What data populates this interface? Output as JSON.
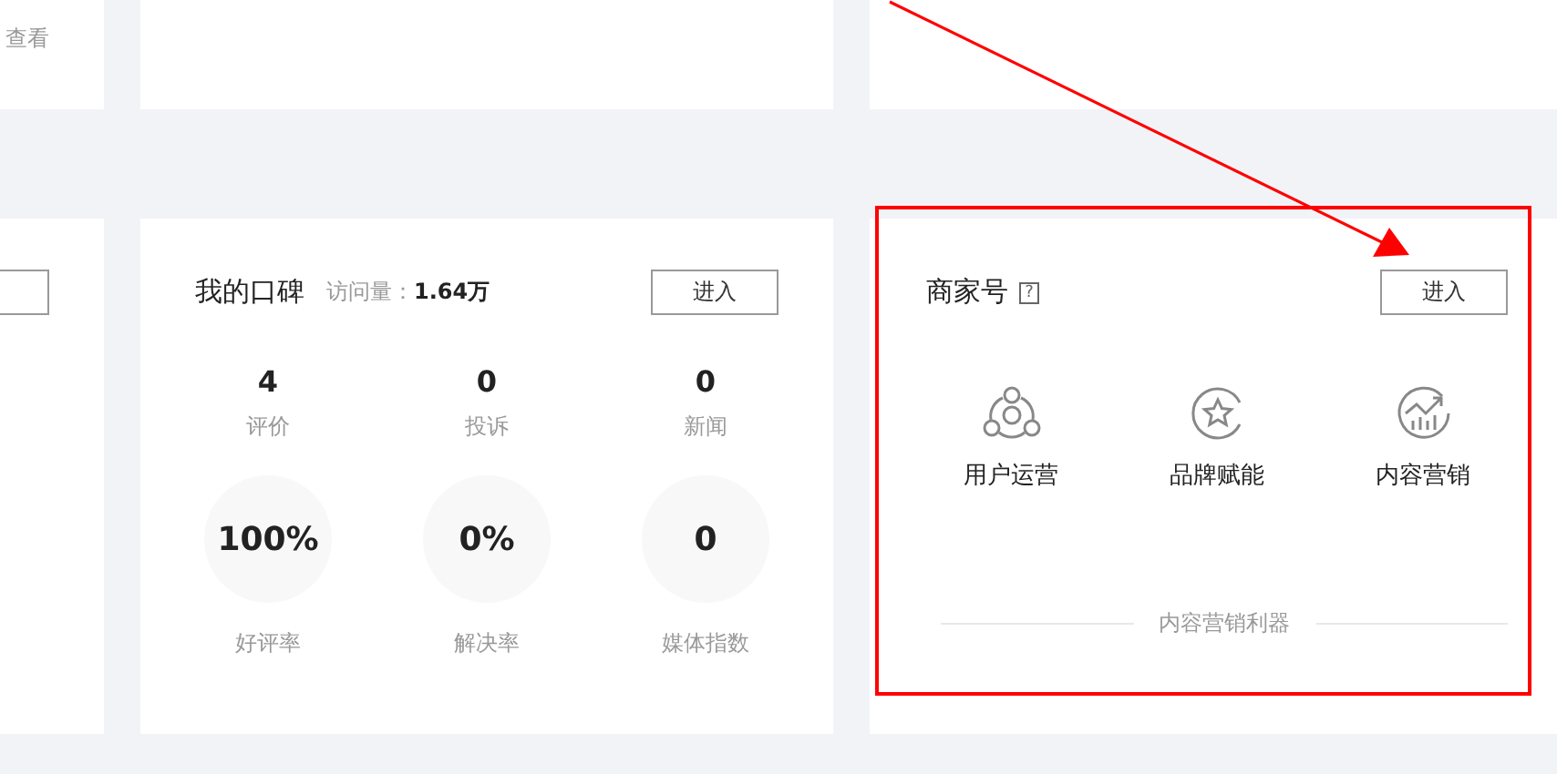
{
  "side_card": {
    "link": "查看"
  },
  "review_card": {
    "title": "我的口碑",
    "visits_label": "访问量：",
    "visits_value": "1.64万",
    "button": "进入",
    "counts": [
      {
        "value": "4",
        "label": "评价"
      },
      {
        "value": "0",
        "label": "投诉"
      },
      {
        "value": "0",
        "label": "新闻"
      }
    ],
    "rates": [
      {
        "value": "100%",
        "label": "好评率"
      },
      {
        "value": "0%",
        "label": "解决率"
      },
      {
        "value": "0",
        "label": "媒体指数"
      }
    ]
  },
  "merchant_card": {
    "title": "商家号",
    "help": "?",
    "button": "进入",
    "features": [
      {
        "label": "用户运营"
      },
      {
        "label": "品牌赋能"
      },
      {
        "label": "内容营销"
      }
    ],
    "footer": "内容营销利器"
  }
}
